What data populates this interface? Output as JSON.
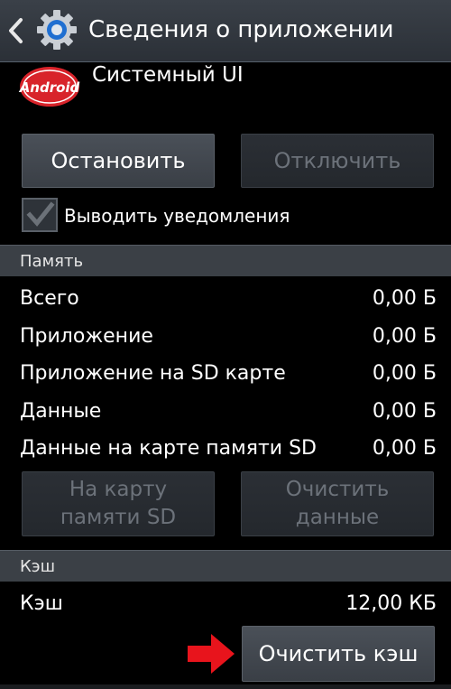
{
  "header": {
    "title": "Сведения о приложении",
    "back_icon": "back-chevron-icon",
    "settings_icon": "gear-icon"
  },
  "app": {
    "name": "Системный UI",
    "logo_text": "Android"
  },
  "buttons": {
    "stop": "Остановить",
    "disable": "Отключить",
    "move_to_sd_line1": "На карту",
    "move_to_sd_line2": "памяти SD",
    "clear_data_line1": "Очистить",
    "clear_data_line2": "данные",
    "clear_cache": "Очистить кэш"
  },
  "notifications": {
    "label": "Выводить уведомления",
    "checked": true
  },
  "storage": {
    "header": "Память",
    "rows": [
      {
        "label": "Всего",
        "value": "0,00 Б"
      },
      {
        "label": "Приложение",
        "value": "0,00 Б"
      },
      {
        "label": "Приложение на SD карте",
        "value": "0,00 Б"
      },
      {
        "label": "Данные",
        "value": "0,00 Б"
      },
      {
        "label": "Данные на карте памяти SD",
        "value": "0,00 Б"
      }
    ]
  },
  "cache": {
    "header": "Кэш",
    "label": "Кэш",
    "value": "12,00 КБ"
  },
  "colors": {
    "background": "#000000",
    "section_bg": "#3b4046",
    "arrow": "#e8141c"
  }
}
